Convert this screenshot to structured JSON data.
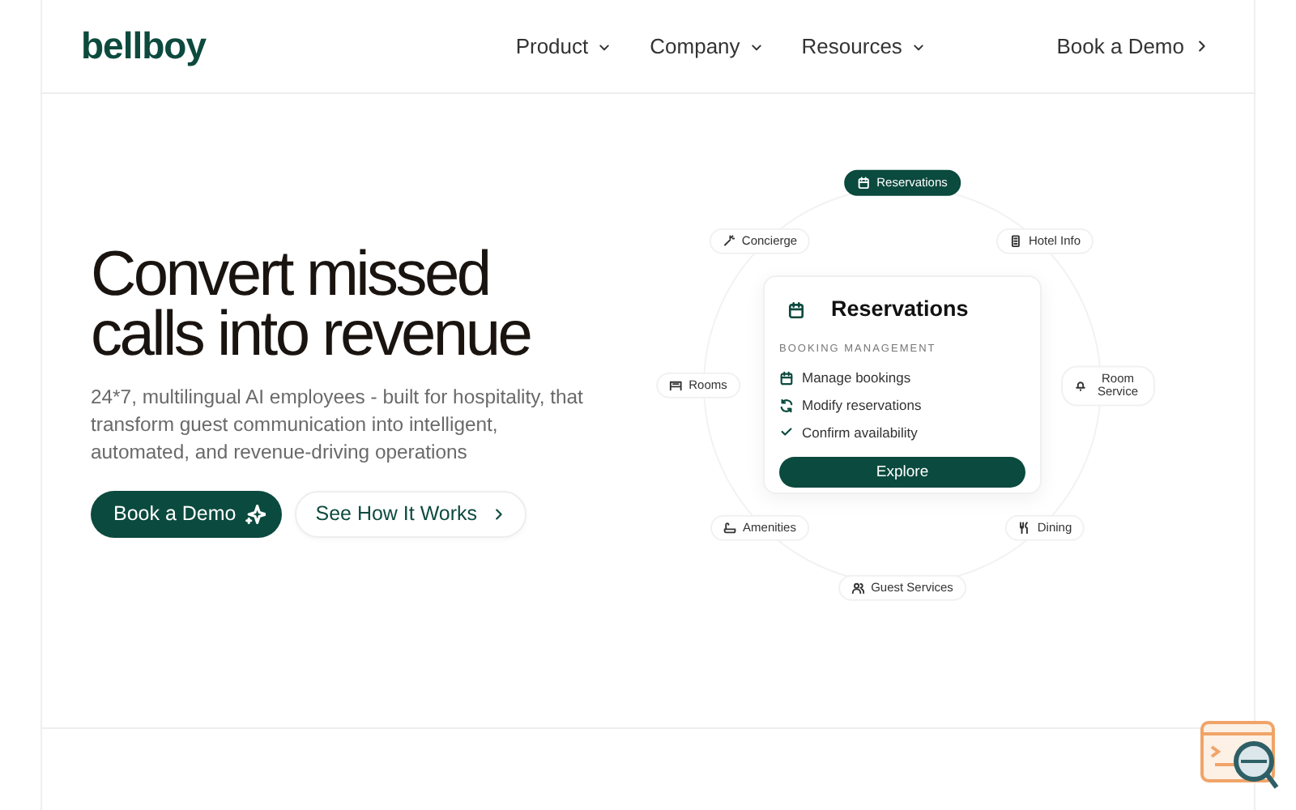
{
  "logo": "bellboy",
  "nav": [
    {
      "label": "Product"
    },
    {
      "label": "Company"
    },
    {
      "label": "Resources"
    }
  ],
  "header_cta": "Book a Demo",
  "hero": {
    "title": "Convert missed calls into revenue",
    "subtitle": "24*7, multilingual AI employees - built for hospitality, that transform guest communication into intelligent, automated, and revenue-driving operations",
    "primary_button": "Book a Demo",
    "secondary_button": "See How It Works"
  },
  "orbit": [
    {
      "label": "Reservations",
      "selected": true
    },
    {
      "label": "Hotel Info",
      "selected": false
    },
    {
      "label": "Room Service",
      "selected": false
    },
    {
      "label": "Dining",
      "selected": false
    },
    {
      "label": "Guest Services",
      "selected": false
    },
    {
      "label": "Amenities",
      "selected": false
    },
    {
      "label": "Rooms",
      "selected": false
    },
    {
      "label": "Concierge",
      "selected": false
    }
  ],
  "card": {
    "title": "Reservations",
    "subtitle": "BOOKING MANAGEMENT",
    "features": [
      "Manage bookings",
      "Modify reservations",
      "Confirm availability"
    ],
    "button": "Explore"
  }
}
